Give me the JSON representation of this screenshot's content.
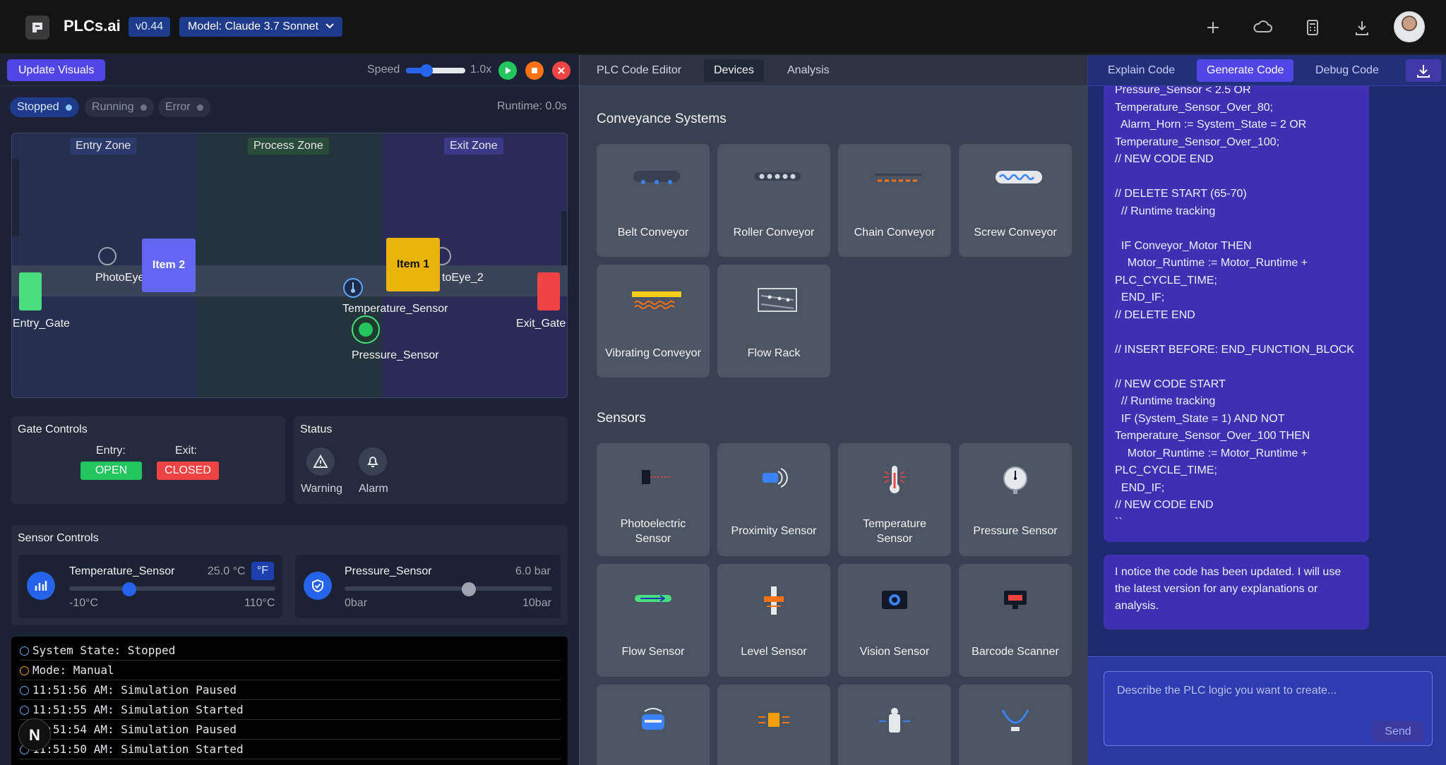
{
  "header": {
    "title": "PLCs.ai",
    "version": "v0.44",
    "model": "Model: Claude 3.7 Sonnet"
  },
  "simulation": {
    "update_label": "Update Visuals",
    "speed_label": "Speed",
    "speed_value": "1.0x",
    "speed_level": 0.3,
    "states": [
      "Stopped",
      "Running",
      "Error"
    ],
    "runtime": "Runtime: 0.0s",
    "zones": [
      "Entry Zone",
      "Process Zone",
      "Exit Zone"
    ],
    "items": [
      "Item 2",
      "Item 1"
    ],
    "labels": {
      "photoeye_1": "PhotoEye",
      "photoeye_2": "toEye_2",
      "entry_gate": "Entry_Gate",
      "exit_gate": "Exit_Gate",
      "temperature": "Temperature_Sensor",
      "pressure": "Pressure_Sensor"
    },
    "colors": {
      "entry_gate": "#4ade80",
      "exit_gate": "#ef4444",
      "item1": "#eab308",
      "item2": "#6366f1"
    }
  },
  "gate_controls": {
    "title": "Gate Controls",
    "entry_label": "Entry:",
    "entry_value": "OPEN",
    "exit_label": "Exit:",
    "exit_value": "CLOSED"
  },
  "status": {
    "title": "Status",
    "warning": "Warning",
    "alarm": "Alarm"
  },
  "sensor_controls": {
    "title": "Sensor Controls",
    "temperature": {
      "name": "Temperature_Sensor",
      "value": "25.0 °C",
      "unit_toggle": "°F",
      "min": "-10°C",
      "max": "110°C",
      "level": 0.29
    },
    "pressure": {
      "name": "Pressure_Sensor",
      "value": "6.0 bar",
      "min": "0bar",
      "max": "10bar",
      "level": 0.6
    }
  },
  "console": [
    "System State: Stopped",
    "Mode: Manual",
    "11:51:56 AM: Simulation Paused",
    "11:51:55 AM: Simulation Started",
    "11:51:54 AM: Simulation Paused",
    "11:51:50 AM: Simulation Started"
  ],
  "middle": {
    "tabs": [
      "PLC Code Editor",
      "Devices",
      "Analysis"
    ],
    "conveyance_title": "Conveyance Systems",
    "conveyance": [
      "Belt Conveyor",
      "Roller Conveyor",
      "Chain Conveyor",
      "Screw Conveyor",
      "Vibrating Conveyor",
      "Flow Rack"
    ],
    "sensors_title": "Sensors",
    "sensors": [
      [
        "Photoelectric",
        "Sensor"
      ],
      [
        "Proximity Sensor"
      ],
      [
        "Temperature",
        "Sensor"
      ],
      [
        "Pressure Sensor"
      ],
      [
        "Flow Sensor"
      ],
      [
        "Level Sensor"
      ],
      [
        "Vision Sensor"
      ],
      [
        "Barcode Scanner"
      ]
    ]
  },
  "right": {
    "tabs": [
      "Explain Code",
      "Generate Code",
      "Debug Code"
    ],
    "code_lines": [
      "Pressure_Sensor < 2.5 OR",
      "Temperature_Sensor_Over_80;",
      "  Alarm_Horn := System_State = 2 OR",
      "Temperature_Sensor_Over_100;",
      "// NEW CODE END",
      "",
      "// DELETE START (65-70)",
      "  // Runtime tracking",
      "",
      "  IF Conveyor_Motor THEN",
      "    Motor_Runtime := Motor_Runtime +",
      "PLC_CYCLE_TIME;",
      "  END_IF;",
      "// DELETE END",
      "",
      "// INSERT BEFORE: END_FUNCTION_BLOCK",
      "",
      "// NEW CODE START",
      "  // Runtime tracking",
      "  IF (System_State = 1) AND NOT",
      "Temperature_Sensor_Over_100 THEN",
      "    Motor_Runtime := Motor_Runtime +",
      "PLC_CYCLE_TIME;",
      "  END_IF;",
      "// NEW CODE END",
      "``"
    ],
    "note_lines": [
      "I notice the code has been updated. I will use",
      "the latest version for any explanations or",
      "analysis."
    ],
    "input_placeholder": "Describe the PLC logic you want to create...",
    "send_label": "Send"
  },
  "floating_badge": "N"
}
